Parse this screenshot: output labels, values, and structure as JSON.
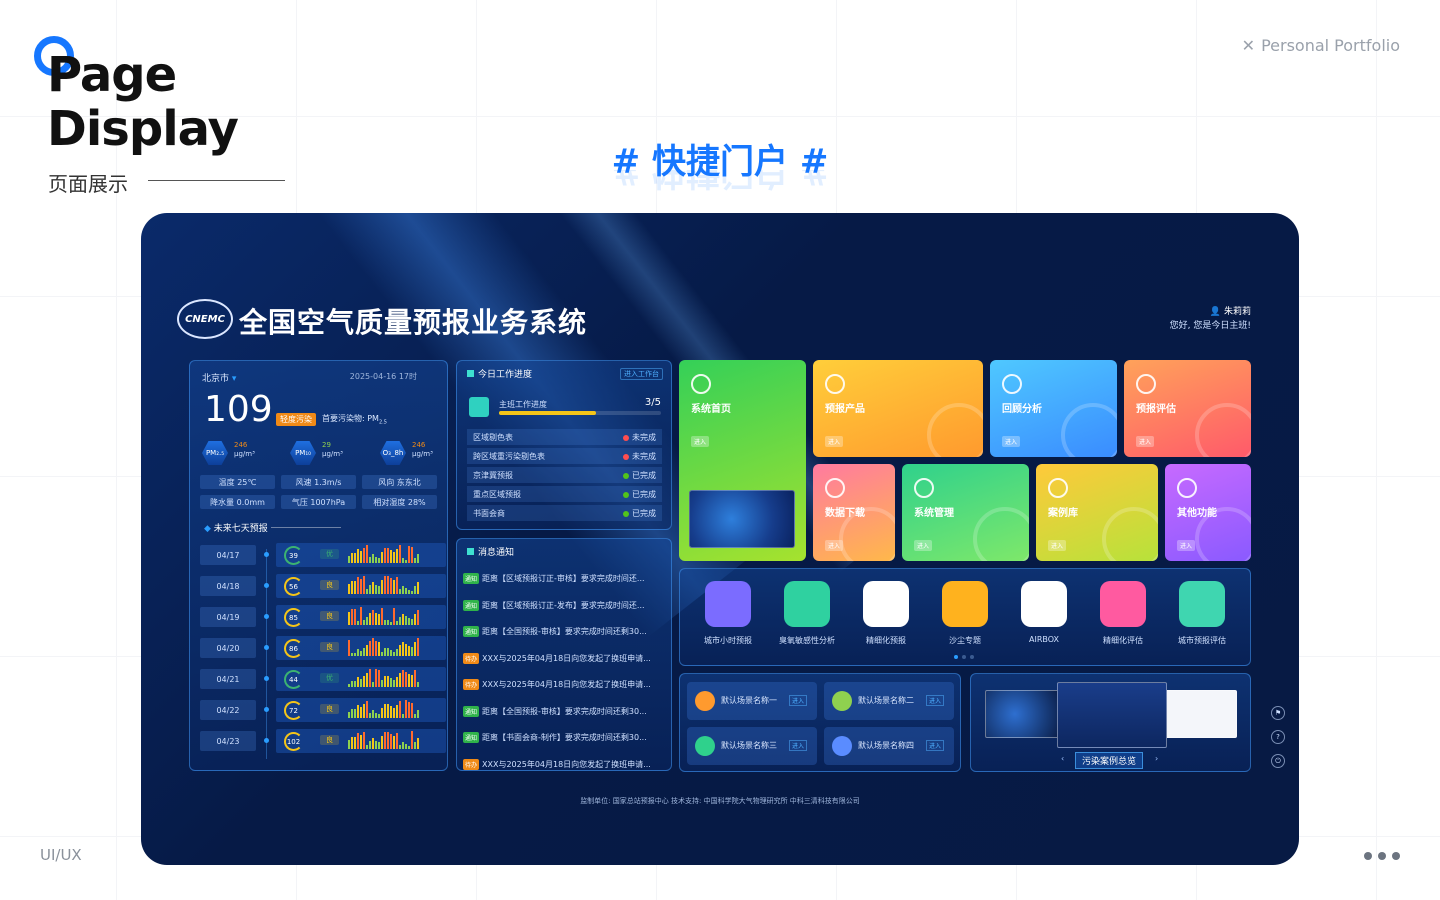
{
  "header": {
    "title_line1": "Page",
    "title_line2": "Display",
    "subtitle": "页面展示",
    "portfolio": "Personal Portfolio",
    "hero": "# 快捷门户 #",
    "footer_left": "UI/UX"
  },
  "dashboard": {
    "logo_text": "CNEMC",
    "title": "全国空气质量预报业务系统",
    "user": {
      "name": "朱莉莉",
      "greeting": "您好, 您是今日主班!"
    },
    "aqi_panel": {
      "city": "北京市",
      "date": "2025-04-16 17时",
      "aqi": "109",
      "level": "轻度污染",
      "primary": "首要污染物: PM",
      "pollutants": [
        {
          "name": "PM₂.₅",
          "value": "246",
          "unit": "μg/m³",
          "color": "#f08a17"
        },
        {
          "name": "PM₁₀",
          "value": "29",
          "unit": "μg/m³",
          "color": "#8fd14f"
        },
        {
          "name": "O₃_8h",
          "value": "246",
          "unit": "μg/m³",
          "color": "#f08a17"
        }
      ],
      "metrics": [
        {
          "label": "温度",
          "value": "25℃"
        },
        {
          "label": "风速",
          "value": "1.3m/s"
        },
        {
          "label": "风向",
          "value": "东东北"
        },
        {
          "label": "降水量",
          "value": "0.0mm"
        },
        {
          "label": "气压",
          "value": "1007hPa"
        },
        {
          "label": "相对湿度",
          "value": "28%"
        }
      ],
      "forecast_title": "未来七天预报",
      "forecast": [
        {
          "date": "04/17",
          "aqi": "39",
          "grade": "优",
          "color": "#3cb371"
        },
        {
          "date": "04/18",
          "aqi": "56",
          "grade": "良",
          "color": "#f5c518"
        },
        {
          "date": "04/19",
          "aqi": "85",
          "grade": "良",
          "color": "#f5c518"
        },
        {
          "date": "04/20",
          "aqi": "86",
          "grade": "良",
          "color": "#f5c518"
        },
        {
          "date": "04/21",
          "aqi": "44",
          "grade": "优",
          "color": "#3cb371"
        },
        {
          "date": "04/22",
          "aqi": "72",
          "grade": "良",
          "color": "#f5c518"
        },
        {
          "date": "04/23",
          "aqi": "102",
          "grade": "良",
          "color": "#f5c518"
        }
      ]
    },
    "progress_panel": {
      "title": "今日工作进度",
      "enter": "进入工作台",
      "label": "主班工作进度",
      "value": "3/5",
      "fraction": 0.6,
      "tasks": [
        {
          "name": "区域剔色表",
          "status": "未完成",
          "color": "#ff4d4f"
        },
        {
          "name": "跨区域重污染剔色表",
          "status": "未完成",
          "color": "#ff4d4f"
        },
        {
          "name": "京津冀预报",
          "status": "已完成",
          "color": "#52c41a"
        },
        {
          "name": "重点区域预报",
          "status": "已完成",
          "color": "#52c41a"
        },
        {
          "name": "书面会商",
          "status": "已完成",
          "color": "#52c41a"
        }
      ]
    },
    "msg_panel": {
      "title": "消息通知",
      "messages": [
        {
          "tag": "通知",
          "text": "距离【区域预报订正-审核】要求完成时间还...",
          "color": "#2fb34a"
        },
        {
          "tag": "通知",
          "text": "距离【区域预报订正-发布】要求完成时间还...",
          "color": "#2fb34a"
        },
        {
          "tag": "通知",
          "text": "距离【全国预报-审核】要求完成时间还剩30...",
          "color": "#2fb34a"
        },
        {
          "tag": "待办",
          "text": "XXX与2025年04月18日向您发起了换班申请...",
          "color": "#f08a17"
        },
        {
          "tag": "待办",
          "text": "XXX与2025年04月18日向您发起了换班申请...",
          "color": "#f08a17"
        },
        {
          "tag": "通知",
          "text": "距离【全国预报-审核】要求完成时间还剩30...",
          "color": "#2fb34a"
        },
        {
          "tag": "通知",
          "text": "距离【书面会商-制作】要求完成时间还剩30...",
          "color": "#2fb34a"
        },
        {
          "tag": "待办",
          "text": "XXX与2025年04月18日向您发起了换班申请...",
          "color": "#f08a17"
        }
      ]
    },
    "tiles": [
      {
        "label": "系统首页",
        "enter": "进入",
        "gradient": "linear-gradient(160deg,#34d058,#a6e22e)"
      },
      {
        "label": "预报产品",
        "enter": "进入",
        "gradient": "linear-gradient(160deg,#ffce3a,#ff9a2e)"
      },
      {
        "label": "回顾分析",
        "enter": "进入",
        "gradient": "linear-gradient(160deg,#4fc8ff,#3a8cff)"
      },
      {
        "label": "预报评估",
        "enter": "进入",
        "gradient": "linear-gradient(160deg,#ffa25a,#ff5a6a)"
      },
      {
        "label": "数据下载",
        "enter": "进入",
        "gradient": "linear-gradient(160deg,#ff7aa0,#ffb84a)"
      },
      {
        "label": "系统管理",
        "enter": "进入",
        "gradient": "linear-gradient(160deg,#2fd18c,#7ee86a)"
      },
      {
        "label": "案例库",
        "enter": "进入",
        "gradient": "linear-gradient(160deg,#ffc93a,#b7e23a)"
      },
      {
        "label": "其他功能",
        "enter": "进入",
        "gradient": "linear-gradient(160deg,#c76aff,#8a5aff)"
      }
    ],
    "apps": [
      {
        "label": "城市小时预报",
        "color": "#7b6cff"
      },
      {
        "label": "臭氧敏感性分析",
        "color": "#2fd1a0"
      },
      {
        "label": "精细化预报",
        "color": "#ffffff"
      },
      {
        "label": "沙尘专题",
        "color": "#ffb21e"
      },
      {
        "label": "AIRBOX",
        "color": "#ffffff"
      },
      {
        "label": "精细化评估",
        "color": "#ff5aa0"
      },
      {
        "label": "城市预报评估",
        "color": "#3fd6b0"
      }
    ],
    "scenes": [
      {
        "label": "默认场景名称一",
        "enter": "进入",
        "color": "#ff9a2e"
      },
      {
        "label": "默认场景名称二",
        "enter": "进入",
        "color": "#8fd14f"
      },
      {
        "label": "默认场景名称三",
        "enter": "进入",
        "color": "#2fd18c"
      },
      {
        "label": "默认场景名称四",
        "enter": "进入",
        "color": "#5a8cff"
      }
    ],
    "case_label": "污染案例总览",
    "footer": "监制单位: 国家总站预报中心    技术支持: 中国科学院大气物理研究所    中科三清科技有限公司"
  }
}
